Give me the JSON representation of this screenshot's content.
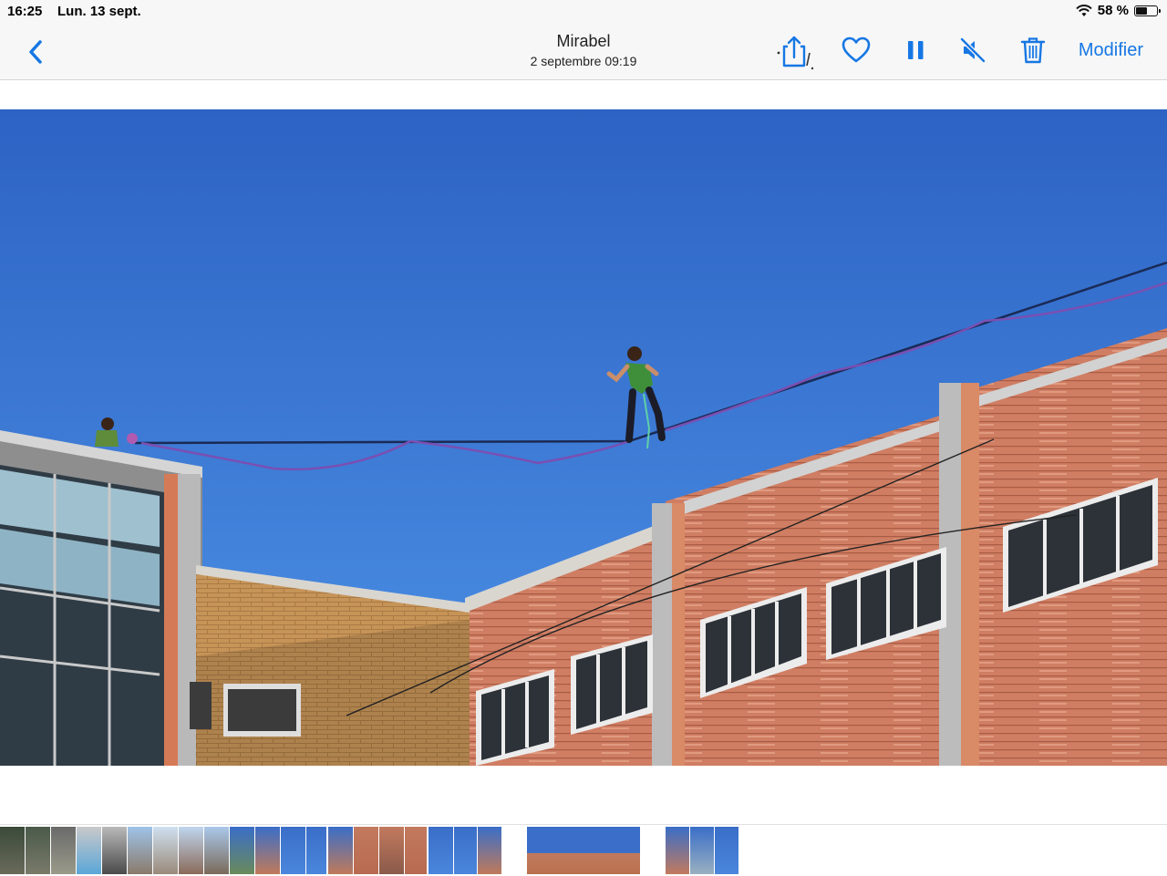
{
  "status_bar": {
    "time": "16:25",
    "date": "Lun. 13 sept.",
    "battery": "58 %",
    "battery_level": 0.58
  },
  "navbar": {
    "title": "Mirabel",
    "subtitle": "2 septembre  09:19",
    "edit_label": "Modifier",
    "accent_color": "#1677e4",
    "icons": [
      "chevron-left-icon",
      "share-icon",
      "heart-icon",
      "pause-icon",
      "speaker-muted-icon",
      "trash-icon"
    ]
  },
  "media": {
    "type": "video-frame"
  },
  "filmstrip": {
    "thumbnail_count": 25
  }
}
